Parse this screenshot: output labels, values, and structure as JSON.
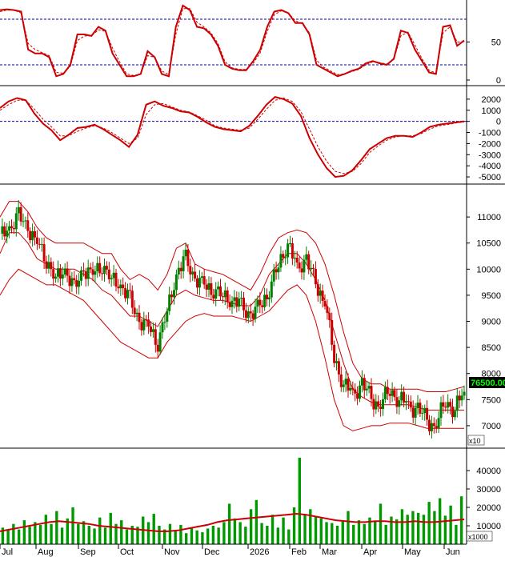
{
  "chart_data": [
    {
      "type": "line",
      "name": "stochastic-oscillator",
      "ylim": [
        0,
        100
      ],
      "y_ticks": [
        "50",
        "0"
      ],
      "reference_levels": [
        80,
        20
      ],
      "series": [
        {
          "color": "#cc0000",
          "style": "solid",
          "values": [
            92,
            93,
            92,
            90,
            40,
            35,
            35,
            30,
            5,
            8,
            20,
            60,
            60,
            58,
            70,
            65,
            35,
            20,
            5,
            5,
            8,
            38,
            30,
            8,
            5,
            70,
            98,
            92,
            70,
            68,
            60,
            45,
            20,
            15,
            13,
            13,
            25,
            40,
            70,
            90,
            92,
            88,
            75,
            75,
            60,
            20,
            15,
            10,
            5,
            8,
            12,
            15,
            22,
            25,
            22,
            20,
            28,
            65,
            62,
            40,
            25,
            10,
            8,
            70,
            72,
            45,
            52
          ]
        },
        {
          "color": "#cc0000",
          "style": "dashed",
          "values": [
            90,
            92,
            92,
            88,
            48,
            40,
            36,
            32,
            10,
            9,
            18,
            52,
            58,
            58,
            66,
            64,
            42,
            24,
            8,
            6,
            8,
            32,
            30,
            12,
            7,
            60,
            94,
            94,
            76,
            70,
            62,
            48,
            24,
            16,
            14,
            14,
            22,
            36,
            64,
            86,
            91,
            88,
            78,
            74,
            62,
            26,
            17,
            12,
            7,
            8,
            11,
            14,
            20,
            24,
            23,
            21,
            27,
            58,
            63,
            46,
            28,
            13,
            9,
            62,
            70,
            50,
            50
          ]
        }
      ]
    },
    {
      "type": "line",
      "name": "macd-oscillator",
      "ylim": [
        -5500,
        3000
      ],
      "y_ticks": [
        "2000",
        "1000",
        "0",
        "-1000",
        "-2000",
        "-3000",
        "-4000",
        "-5000"
      ],
      "reference_levels": [
        0
      ],
      "series": [
        {
          "color": "#cc0000",
          "style": "solid",
          "values": [
            1200,
            1800,
            2100,
            1900,
            700,
            -200,
            -800,
            -1700,
            -1200,
            -600,
            -500,
            -300,
            -700,
            -1200,
            -1700,
            -2300,
            -1200,
            1500,
            1800,
            1400,
            1200,
            900,
            800,
            400,
            -100,
            -500,
            -700,
            -800,
            -900,
            -400,
            500,
            1500,
            2200,
            2000,
            1600,
            500,
            -1500,
            -3000,
            -4200,
            -5000,
            -4900,
            -4400,
            -3500,
            -2500,
            -2000,
            -1500,
            -1300,
            -1300,
            -1400,
            -1000,
            -500,
            -300,
            -200,
            -100,
            0
          ]
        },
        {
          "color": "#cc0000",
          "style": "dashed",
          "values": [
            1000,
            1500,
            1900,
            1900,
            1100,
            200,
            -500,
            -1300,
            -1300,
            -900,
            -600,
            -400,
            -600,
            -1000,
            -1500,
            -2000,
            -1500,
            600,
            1500,
            1600,
            1300,
            1000,
            850,
            500,
            100,
            -400,
            -600,
            -700,
            -800,
            -600,
            200,
            1100,
            1900,
            2100,
            1800,
            900,
            -700,
            -2300,
            -3600,
            -4500,
            -4700,
            -4500,
            -3800,
            -2800,
            -2200,
            -1700,
            -1400,
            -1300,
            -1300,
            -1100,
            -700,
            -400,
            -300,
            -150,
            -50
          ]
        }
      ]
    },
    {
      "type": "candlestick",
      "name": "price-with-bollinger-bands",
      "ylim": [
        6600,
        11600
      ],
      "y_ticks": [
        "11000",
        "10500",
        "10000",
        "9500",
        "9000",
        "8500",
        "8000",
        "7500",
        "7000"
      ],
      "scale_label": "x10",
      "last_price_label": "76500.00",
      "x_labels": [
        "Jul",
        "Aug",
        "Sep",
        "Oct",
        "Nov",
        "Dec",
        "2026",
        "Feb",
        "Mar",
        "Apr",
        "May",
        "Jun"
      ],
      "close": [
        10600,
        10800,
        11000,
        10800,
        10500,
        10200,
        9800,
        10000,
        9600,
        10000,
        9900,
        10100,
        9800,
        9700,
        9400,
        9000,
        8900,
        8600,
        9200,
        9900,
        10200,
        9800,
        9700,
        9600,
        9500,
        9400,
        9300,
        9100,
        9300,
        9600,
        10100,
        10500,
        10000,
        10200,
        9700,
        9400,
        8300,
        7800,
        7600,
        7800,
        7500,
        7400,
        7700,
        7500,
        7400,
        7300,
        7100,
        7000,
        7500,
        7300,
        7650
      ],
      "series": [
        {
          "name": "upper",
          "color": "#cc0000",
          "values": [
            11000,
            11300,
            11300,
            11100,
            10800,
            10600,
            10500,
            10500,
            10500,
            10500,
            10400,
            10300,
            10300,
            10000,
            9800,
            9900,
            9800,
            9600,
            9900,
            10400,
            10500,
            10100,
            10000,
            9950,
            9900,
            9800,
            9700,
            9600,
            9900,
            10300,
            10600,
            10700,
            10750,
            10700,
            10500,
            10100,
            9500,
            8800,
            8200,
            7900,
            7800,
            7800,
            7700,
            7700,
            7700,
            7700,
            7650,
            7650,
            7650,
            7700,
            7750
          ]
        },
        {
          "name": "middle",
          "color": "#cc0000",
          "values": [
            10300,
            10700,
            10700,
            10500,
            10200,
            10100,
            10000,
            10000,
            10000,
            9900,
            9800,
            9600,
            9500,
            9300,
            9100,
            9100,
            9000,
            8900,
            9200,
            9500,
            9600,
            9500,
            9450,
            9400,
            9400,
            9350,
            9300,
            9300,
            9500,
            9900,
            10100,
            10300,
            10300,
            10100,
            9800,
            9400,
            8800,
            8200,
            7700,
            7550,
            7450,
            7400,
            7400,
            7400,
            7400,
            7350,
            7300,
            7300,
            7300,
            7300,
            7300
          ]
        },
        {
          "name": "lower",
          "color": "#cc0000",
          "values": [
            9500,
            9800,
            10000,
            9900,
            9800,
            9700,
            9700,
            9600,
            9500,
            9400,
            9200,
            9000,
            8800,
            8600,
            8500,
            8400,
            8300,
            8300,
            8600,
            8800,
            9000,
            9100,
            9150,
            9100,
            9100,
            9100,
            9050,
            9000,
            9100,
            9200,
            9400,
            9600,
            9700,
            9500,
            9000,
            8300,
            7500,
            7000,
            6900,
            6950,
            7000,
            7000,
            7050,
            7050,
            7050,
            7000,
            6950,
            6950,
            6950,
            6950,
            6950
          ]
        }
      ]
    },
    {
      "type": "bar",
      "name": "volume",
      "ylim": [
        0,
        50000
      ],
      "y_ticks": [
        "40000",
        "30000",
        "20000",
        "10000"
      ],
      "scale_label": "x1000",
      "values": [
        9000,
        7500,
        11000,
        8000,
        13000,
        9500,
        12000,
        10500,
        16000,
        11000,
        18000,
        9000,
        14000,
        20000,
        11000,
        12500,
        10000,
        8500,
        14500,
        9000,
        17000,
        11000,
        13000,
        8000,
        10000,
        9500,
        15000,
        12000,
        16500,
        10000,
        8000,
        11000,
        7000,
        10500,
        6000,
        9000,
        7500,
        6500,
        8500,
        10000,
        9000,
        12000,
        22000,
        14000,
        12000,
        9500,
        19000,
        24000,
        11500,
        10000,
        16000,
        9000,
        14500,
        8000,
        20000,
        47000,
        16000,
        19000,
        15000,
        14000,
        12000,
        11500,
        10000,
        12500,
        18000,
        10500,
        13000,
        11000,
        14500,
        12500,
        22000,
        10500,
        15000,
        13500,
        19000,
        16000,
        18000,
        17000,
        16000,
        23000,
        18000,
        25000,
        15500,
        21000,
        10500,
        26000
      ],
      "ma_series": {
        "color": "#cc0000",
        "values": [
          7000,
          8000,
          9000,
          10000,
          11000,
          12000,
          12500,
          12000,
          11500,
          11000,
          10000,
          9500,
          9000,
          8500,
          8000,
          7500,
          7000,
          7000,
          7500,
          8500,
          9500,
          10500,
          12000,
          13000,
          13500,
          14000,
          14500,
          15000,
          15500,
          16000,
          16500,
          16000,
          15000,
          14000,
          13000,
          12500,
          12000,
          12000,
          12500,
          12500,
          12000,
          12000,
          12500,
          12000,
          12000,
          12500,
          13000,
          13500
        ]
      }
    }
  ]
}
